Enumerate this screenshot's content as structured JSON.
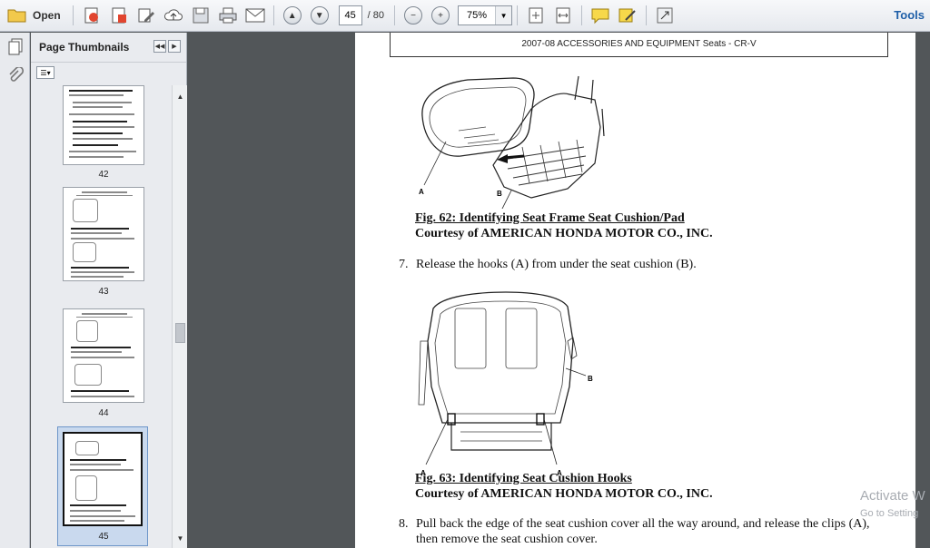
{
  "toolbar": {
    "open_label": "Open",
    "page_current": "45",
    "page_total": "/ 80",
    "zoom": "75%",
    "tools_label": "Tools",
    "icons": [
      "folder-icon",
      "create-pdf-icon",
      "edit-icon",
      "upload-icon",
      "save-icon",
      "print-icon",
      "email-icon",
      "prev-page-icon",
      "next-page-icon",
      "zoom-out-icon",
      "zoom-in-icon",
      "fit-page-icon",
      "fit-width-icon",
      "comment-icon",
      "sign-icon",
      "fullscreen-icon"
    ]
  },
  "thumbnails": {
    "title": "Page Thumbnails",
    "pages": [
      {
        "num": "42"
      },
      {
        "num": "43"
      },
      {
        "num": "44"
      },
      {
        "num": "45",
        "selected": true
      }
    ]
  },
  "document": {
    "header": "2007-08 ACCESSORIES AND EQUIPMENT Seats - CR-V",
    "fig62_caption": "Fig. 62: Identifying Seat Frame Seat Cushion/Pad",
    "fig62_courtesy": "Courtesy of AMERICAN HONDA MOTOR CO., INC.",
    "fig62_labels": {
      "a": "A",
      "b": "B"
    },
    "step7_num": "7.",
    "step7_text": "Release the hooks (A) from under the seat cushion (B).",
    "fig63_caption": "Fig. 63: Identifying Seat Cushion Hooks",
    "fig63_courtesy": "Courtesy of AMERICAN HONDA MOTOR CO., INC.",
    "fig63_labels": {
      "a1": "A",
      "a2": "A",
      "b": "B"
    },
    "step8_num": "8.",
    "step8_text": "Pull back the edge of the seat cushion cover all the way around, and release the clips (A), then remove the seat cushion cover."
  },
  "watermark": {
    "title": "Activate W",
    "sub": "Go to Setting"
  }
}
